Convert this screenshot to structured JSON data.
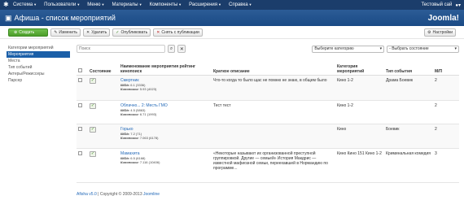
{
  "topnav": {
    "menu": [
      "Система",
      "Пользователи",
      "Меню",
      "Материалы",
      "Компоненты",
      "Расширения",
      "Справка"
    ],
    "site_name": "Тестовый сай"
  },
  "header": {
    "title": "Афиша - список мероприятий",
    "brand": "Joomla!"
  },
  "toolbar": {
    "create": "Создать",
    "edit": "Изменить",
    "delete": "Удалить",
    "publish": "Опубликовать",
    "unpublish": "Снять с публикации",
    "settings": "Настройки"
  },
  "sidebar": {
    "items": [
      "Категории мероприятий",
      "Мероприятия",
      "Места",
      "Тип событий",
      "Актеры/Режиссеры",
      "Парсер"
    ]
  },
  "filters": {
    "search_placeholder": "Поиск",
    "category": "Выберите категорию",
    "state": "- Выбрать состояние"
  },
  "table": {
    "headers": {
      "state": "Состояние",
      "name": "Наименование мероприятия рейтинг кинопоиск",
      "desc": "Краткое описание",
      "category": "Категория мероприятий",
      "type": "Тип события",
      "mp": "М/П"
    },
    "rows": [
      {
        "name": "Смертник",
        "imdb": "6.1 (3336)",
        "kp": "5.93 (4023)",
        "desc": "Что-то когда то было щас не помню не знаю, в общем было",
        "category": "Кино 1-2",
        "type": "Драма Боевик",
        "mp": "2"
      },
      {
        "name": "Облачно... 2: Месть ГМО",
        "imdb": "4.5 (5863)",
        "kp": "6.71 (1993)",
        "desc": "Тест тест",
        "category": "Кино 1-2",
        "type": "",
        "mp": "2"
      },
      {
        "name": "Горько",
        "imdb": "7.2 (71)",
        "kp": "7.063 (6178)",
        "desc": "",
        "category": "Кино",
        "type": "Боевик",
        "mp": "2"
      },
      {
        "name": "Мамахита",
        "imdb": "6.5 (6168)",
        "kp": "7.116 (10406)",
        "desc": "«Некоторые называют их организованной преступной группировкой. Другие — семьей» История Макдрис — известной мафиозной семьи, переехавшей в Нормандию по программе...",
        "category": "Кино Кино 151 Кино 1-2",
        "type": "Криминальная комедия",
        "mp": "3"
      }
    ],
    "imdb_label": "IMDb:",
    "kp_label": "Кинопоиск:"
  },
  "footer": {
    "brand": "Afisha v5.0",
    "copyright": "| Copyright © 2009-2013",
    "joomla": "Joomline"
  }
}
